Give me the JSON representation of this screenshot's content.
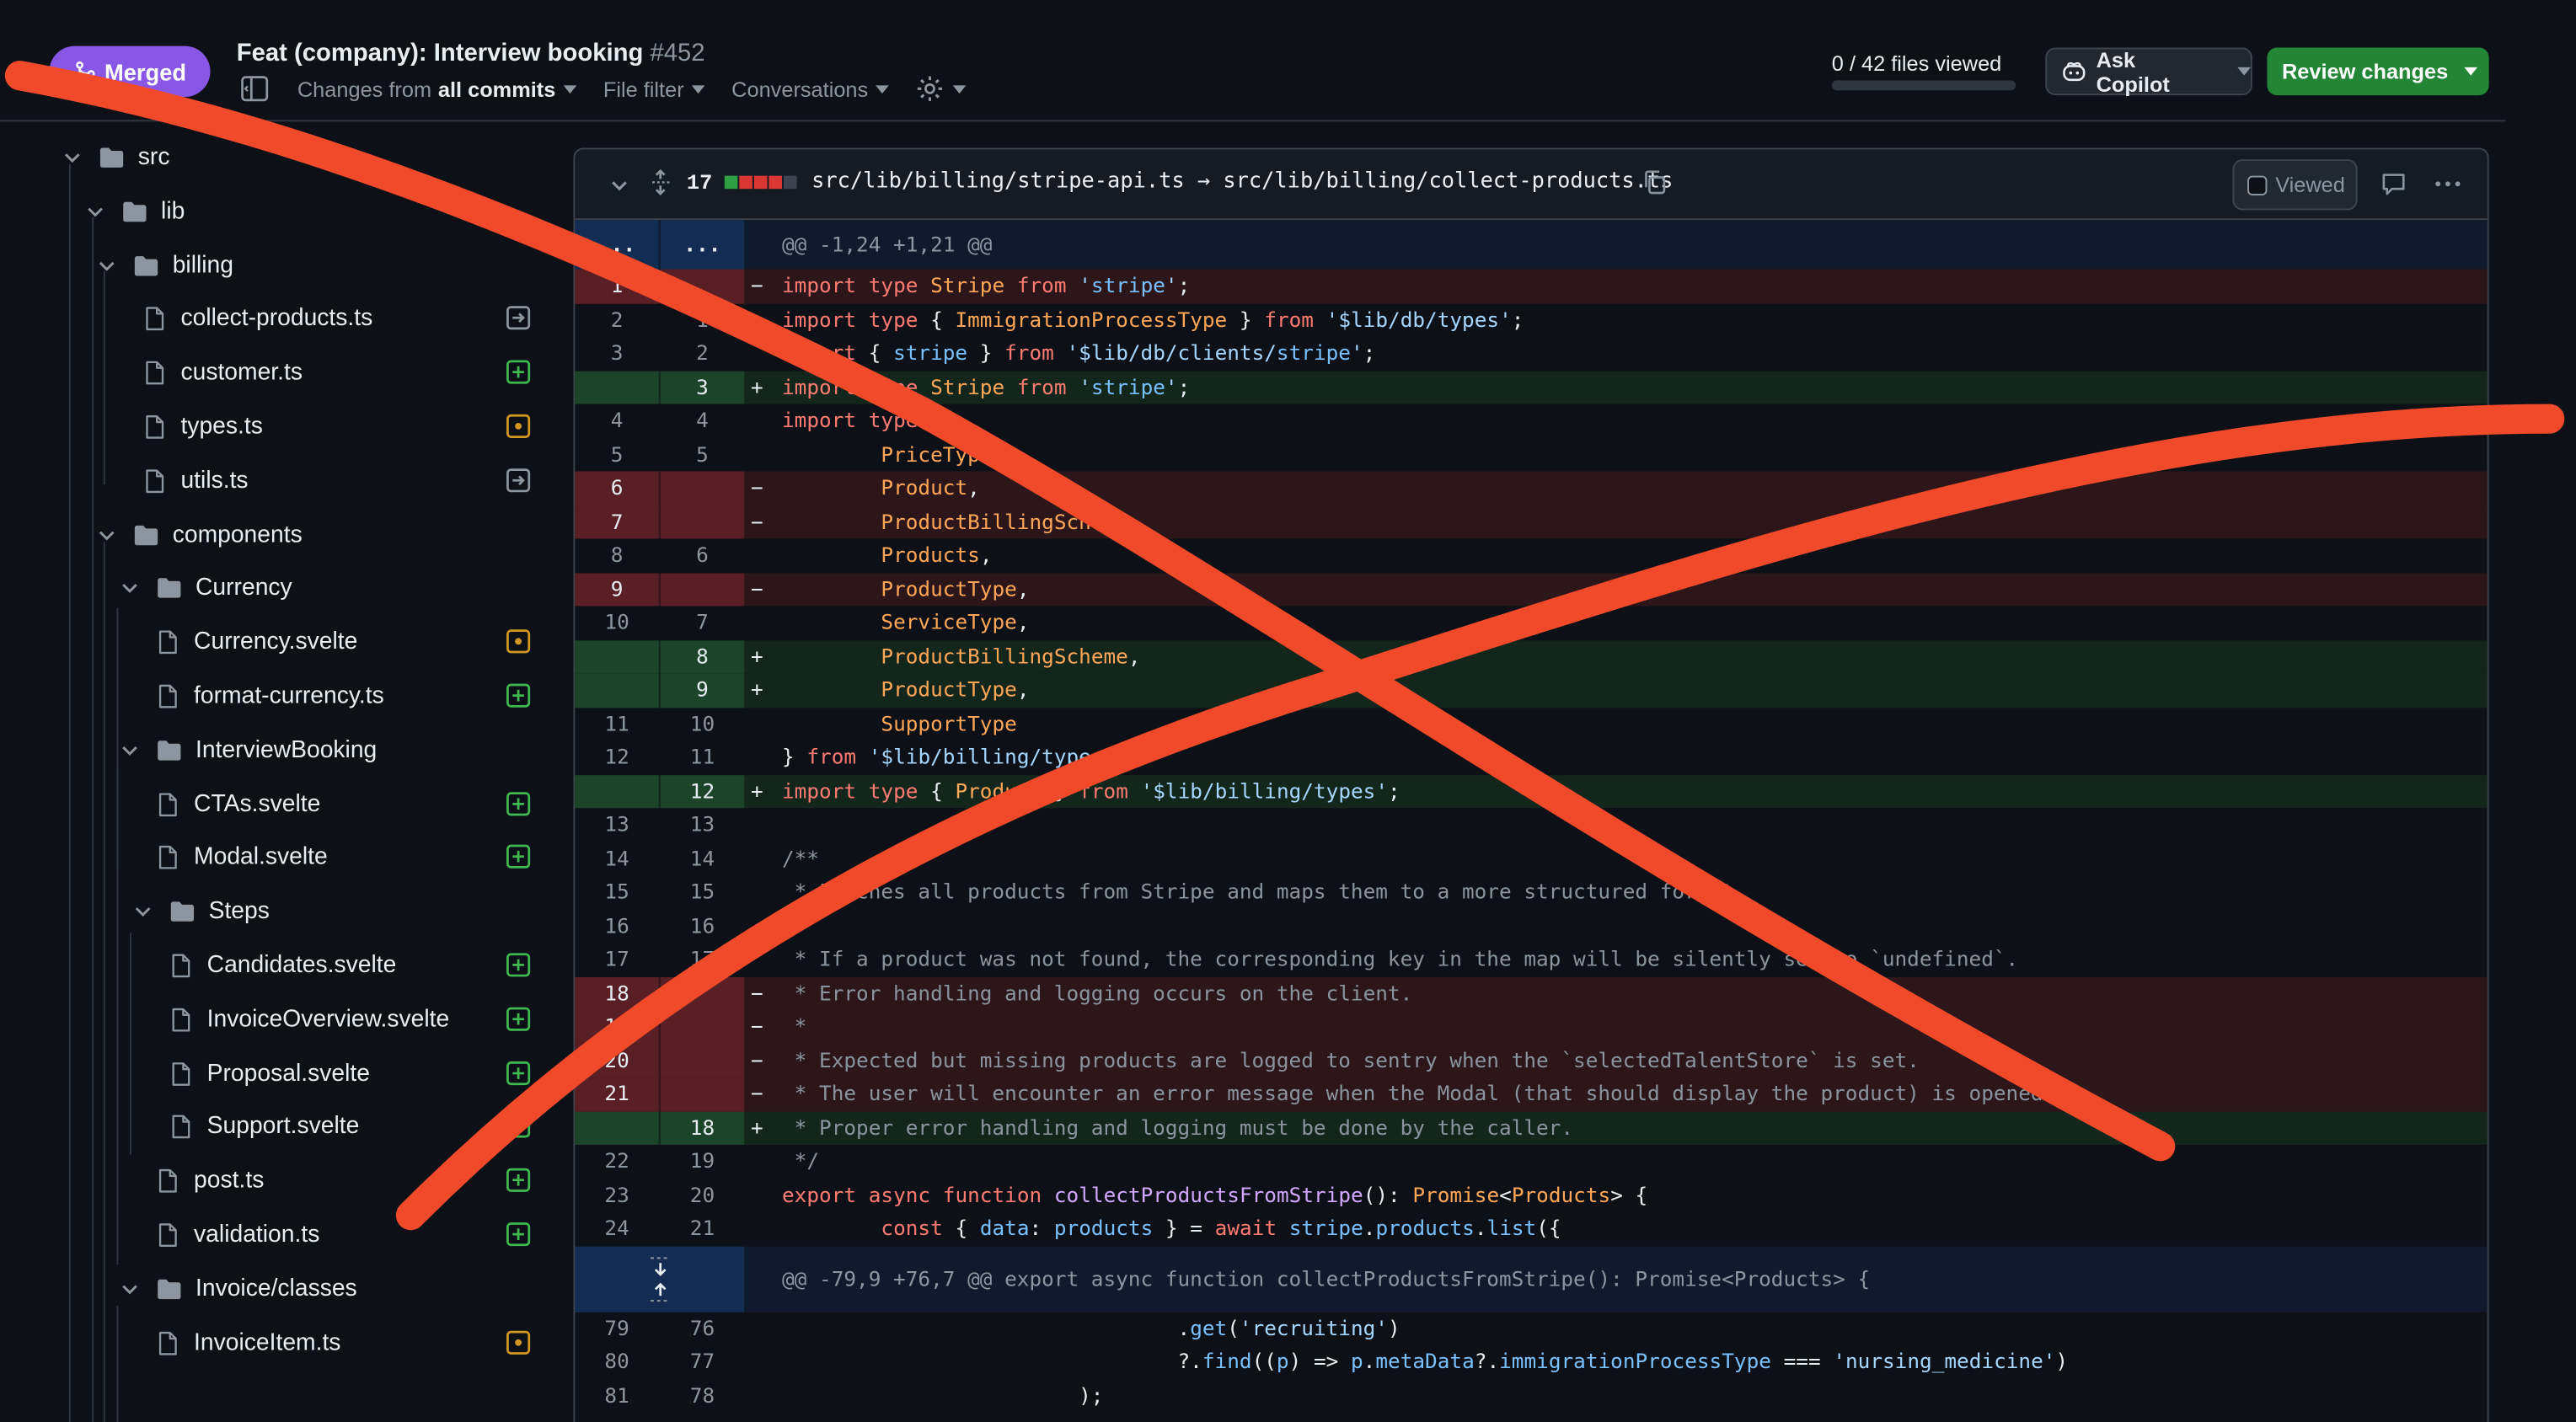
{
  "header": {
    "status_badge": "Merged",
    "pr_title": "Feat (company): Interview booking",
    "pr_number": "#452",
    "changes_prefix": "Changes from",
    "changes_value": "all commits",
    "file_filter": "File filter",
    "conversations": "Conversations",
    "files_viewed": "0 / 42 files viewed",
    "files_viewed_fraction": 0,
    "ask_copilot": "Ask Copilot",
    "review_changes": "Review changes"
  },
  "colors": {
    "merged": "#8957e5",
    "review": "#238636",
    "added": "#3fb950",
    "modified": "#d29922",
    "renamed": "#8d96a0",
    "annotation": "#f04a2b"
  },
  "tree": [
    {
      "label": "src",
      "kind": "folder",
      "depth": 0,
      "status": ""
    },
    {
      "label": "lib",
      "kind": "folder",
      "depth": 1,
      "status": ""
    },
    {
      "label": "billing",
      "kind": "folder",
      "depth": 2,
      "status": ""
    },
    {
      "label": "collect-products.ts",
      "kind": "file",
      "depth": 3,
      "status": "renamed"
    },
    {
      "label": "customer.ts",
      "kind": "file",
      "depth": 3,
      "status": "added"
    },
    {
      "label": "types.ts",
      "kind": "file",
      "depth": 3,
      "status": "modified"
    },
    {
      "label": "utils.ts",
      "kind": "file",
      "depth": 3,
      "status": "renamed"
    },
    {
      "label": "components",
      "kind": "folder",
      "depth": 2,
      "status": ""
    },
    {
      "label": "Currency",
      "kind": "folder",
      "depth": 3,
      "status": ""
    },
    {
      "label": "Currency.svelte",
      "kind": "file",
      "depth": 4,
      "status": "modified"
    },
    {
      "label": "format-currency.ts",
      "kind": "file",
      "depth": 4,
      "status": "added"
    },
    {
      "label": "InterviewBooking",
      "kind": "folder",
      "depth": 3,
      "status": ""
    },
    {
      "label": "CTAs.svelte",
      "kind": "file",
      "depth": 4,
      "status": "added"
    },
    {
      "label": "Modal.svelte",
      "kind": "file",
      "depth": 4,
      "status": "added"
    },
    {
      "label": "Steps",
      "kind": "folder",
      "depth": 4,
      "status": ""
    },
    {
      "label": "Candidates.svelte",
      "kind": "file",
      "depth": 5,
      "status": "added"
    },
    {
      "label": "InvoiceOverview.svelte",
      "kind": "file",
      "depth": 5,
      "status": "added"
    },
    {
      "label": "Proposal.svelte",
      "kind": "file",
      "depth": 5,
      "status": "added"
    },
    {
      "label": "Support.svelte",
      "kind": "file",
      "depth": 5,
      "status": "added"
    },
    {
      "label": "post.ts",
      "kind": "file",
      "depth": 4,
      "status": "added"
    },
    {
      "label": "validation.ts",
      "kind": "file",
      "depth": 4,
      "status": "added"
    },
    {
      "label": "Invoice/classes",
      "kind": "folder",
      "depth": 3,
      "status": ""
    },
    {
      "label": "InvoiceItem.ts",
      "kind": "file",
      "depth": 4,
      "status": "modified"
    }
  ],
  "diff": {
    "changed_count": "17",
    "file_path": "src/lib/billing/stripe-api.ts → src/lib/billing/collect-products.ts",
    "viewed_label": "Viewed",
    "hunk1_dots_old": "...",
    "hunk1_dots_new": "...",
    "lines": [
      {
        "type": "hunk",
        "old": "",
        "new": "",
        "sign": "",
        "code": "@@ -1,24 +1,21 @@"
      },
      {
        "type": "del",
        "old": "1",
        "new": "",
        "sign": "−",
        "code": "import type Stripe from 'stripe';"
      },
      {
        "type": "ctx",
        "old": "2",
        "new": "1",
        "sign": "",
        "code": "import type { ImmigrationProcessType } from '$lib/db/types';"
      },
      {
        "type": "ctx",
        "old": "3",
        "new": "2",
        "sign": "",
        "code": "import { stripe } from '$lib/db/clients/stripe';"
      },
      {
        "type": "add",
        "old": "",
        "new": "3",
        "sign": "+",
        "code": "import type Stripe from 'stripe';"
      },
      {
        "type": "ctx",
        "old": "4",
        "new": "4",
        "sign": "",
        "code": "import type {"
      },
      {
        "type": "ctx",
        "old": "5",
        "new": "5",
        "sign": "",
        "code": "        PriceType,"
      },
      {
        "type": "del",
        "old": "6",
        "new": "",
        "sign": "−",
        "code": "        Product,"
      },
      {
        "type": "del",
        "old": "7",
        "new": "",
        "sign": "−",
        "code": "        ProductBillingScheme,"
      },
      {
        "type": "ctx",
        "old": "8",
        "new": "6",
        "sign": "",
        "code": "        Products,"
      },
      {
        "type": "del",
        "old": "9",
        "new": "",
        "sign": "−",
        "code": "        ProductType,"
      },
      {
        "type": "ctx",
        "old": "10",
        "new": "7",
        "sign": "",
        "code": "        ServiceType,"
      },
      {
        "type": "add",
        "old": "",
        "new": "8",
        "sign": "+",
        "code": "        ProductBillingScheme,"
      },
      {
        "type": "add",
        "old": "",
        "new": "9",
        "sign": "+",
        "code": "        ProductType,"
      },
      {
        "type": "ctx",
        "old": "11",
        "new": "10",
        "sign": "",
        "code": "        SupportType"
      },
      {
        "type": "ctx",
        "old": "12",
        "new": "11",
        "sign": "",
        "code": "} from '$lib/billing/types';"
      },
      {
        "type": "add",
        "old": "",
        "new": "12",
        "sign": "+",
        "code": "import type { Product } from '$lib/billing/types';"
      },
      {
        "type": "ctx",
        "old": "13",
        "new": "13",
        "sign": "",
        "code": ""
      },
      {
        "type": "ctx",
        "old": "14",
        "new": "14",
        "sign": "",
        "code": "/**"
      },
      {
        "type": "ctx",
        "old": "15",
        "new": "15",
        "sign": "",
        "code": " * Fetches all products from Stripe and maps them to a more structured format."
      },
      {
        "type": "ctx",
        "old": "16",
        "new": "16",
        "sign": "",
        "code": ""
      },
      {
        "type": "ctx",
        "old": "17",
        "new": "17",
        "sign": "",
        "code": " * If a product was not found, the corresponding key in the map will be silently set to `undefined`."
      },
      {
        "type": "del",
        "old": "18",
        "new": "",
        "sign": "−",
        "code": " * Error handling and logging occurs on the client."
      },
      {
        "type": "del",
        "old": "19",
        "new": "",
        "sign": "−",
        "code": " *"
      },
      {
        "type": "del",
        "old": "20",
        "new": "",
        "sign": "−",
        "code": " * Expected but missing products are logged to sentry when the `selectedTalentStore` is set."
      },
      {
        "type": "del",
        "old": "21",
        "new": "",
        "sign": "−",
        "code": " * The user will encounter an error message when the Modal (that should display the product) is opened."
      },
      {
        "type": "add",
        "old": "",
        "new": "18",
        "sign": "+",
        "code": " * Proper error handling and logging must be done by the caller."
      },
      {
        "type": "ctx",
        "old": "22",
        "new": "19",
        "sign": "",
        "code": " */"
      },
      {
        "type": "ctx",
        "old": "23",
        "new": "20",
        "sign": "",
        "code": "export async function collectProductsFromStripe(): Promise<Products> {"
      },
      {
        "type": "ctx",
        "old": "24",
        "new": "21",
        "sign": "",
        "code": "        const { data: products } = await stripe.products.list({"
      },
      {
        "type": "hunk2",
        "old": "",
        "new": "",
        "sign": "",
        "code": "@@ -79,9 +76,7 @@ export async function collectProductsFromStripe(): Promise<Products> {"
      },
      {
        "type": "ctx",
        "old": "79",
        "new": "76",
        "sign": "",
        "code": "                                .get('recruiting')"
      },
      {
        "type": "ctx",
        "old": "80",
        "new": "77",
        "sign": "",
        "code": "                                ?.find((p) => p.metaData?.immigrationProcessType === 'nursing_medicine')"
      },
      {
        "type": "ctx",
        "old": "81",
        "new": "78",
        "sign": "",
        "code": "                        );"
      }
    ]
  }
}
